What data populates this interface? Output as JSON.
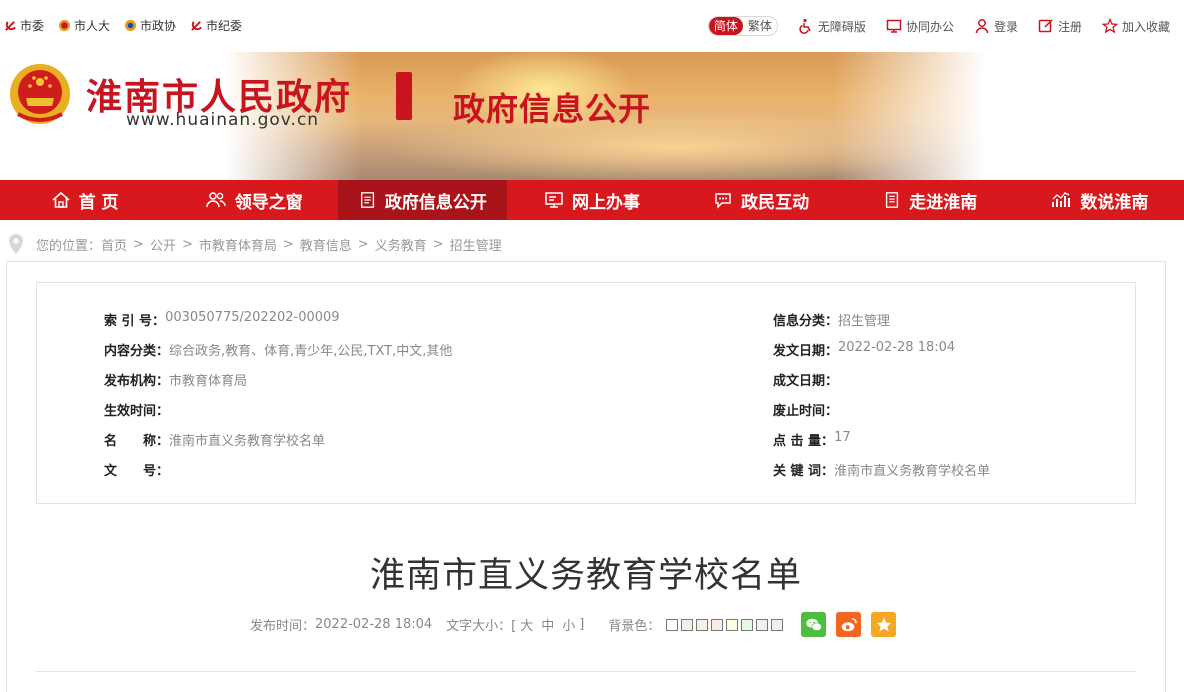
{
  "top_links_left": [
    {
      "label": "市委"
    },
    {
      "label": "市人大"
    },
    {
      "label": "市政协"
    },
    {
      "label": "市纪委"
    }
  ],
  "lang": {
    "simplified": "简体",
    "traditional": "繁体"
  },
  "top_links_right": {
    "accessible": "无障碍版",
    "office": "协同办公",
    "login": "登录",
    "register": "注册",
    "favorite": "加入收藏"
  },
  "banner": {
    "site_name": "淮南市人民政府",
    "site_url": "www.huainan.gov.cn",
    "section": "政府信息公开"
  },
  "nav": [
    {
      "label": "首 页"
    },
    {
      "label": "领导之窗"
    },
    {
      "label": "政府信息公开"
    },
    {
      "label": "网上办事"
    },
    {
      "label": "政民互动"
    },
    {
      "label": "走进淮南"
    },
    {
      "label": "数说淮南"
    }
  ],
  "breadcrumb": {
    "prefix": "您的位置：",
    "items": [
      "首页",
      "公开",
      "市教育体育局",
      "教育信息",
      "义务教育",
      "招生管理"
    ],
    "sep": ">"
  },
  "meta": {
    "index_no": {
      "k": "索 引 号：",
      "v": "003050775/202202-00009"
    },
    "content_cat": {
      "k": "内容分类：",
      "v": "综合政务,教育、体育,青少年,公民,TXT,中文,其他"
    },
    "publisher": {
      "k": "发布机构：",
      "v": "市教育体育局"
    },
    "effective": {
      "k": "生效时间：",
      "v": ""
    },
    "name": {
      "k": "名　　称：",
      "v": "淮南市直义务教育学校名单"
    },
    "doc_no": {
      "k": "文　　号：",
      "v": ""
    },
    "info_cat": {
      "k": "信息分类：",
      "v": "招生管理"
    },
    "issue_date": {
      "k": "发文日期：",
      "v": "2022-02-28 18:04"
    },
    "written_date": {
      "k": "成文日期：",
      "v": ""
    },
    "repeal": {
      "k": "废止时间：",
      "v": ""
    },
    "hits": {
      "k": "点 击 量：",
      "v": "17"
    },
    "keywords": {
      "k": "关 键 词：",
      "v": "淮南市直义务教育学校名单"
    }
  },
  "article": {
    "title": "淮南市直义务教育学校名单",
    "pub_label": "发布时间：",
    "pub_time": "2022-02-28 18:04",
    "font_size_label": "文字大小：[",
    "font_sizes": [
      "大",
      "中",
      "小"
    ],
    "font_size_end": "]",
    "bg_label": "背景色：",
    "bg_colors": [
      "#ffffff",
      "#f3f0e4",
      "#f6f0e8",
      "#fbe9e6",
      "#fdfde0",
      "#e7f7e9",
      "#eef2f8",
      "#f0f0f0"
    ]
  },
  "colors": {
    "brand_red": "#c8141e",
    "nav_red": "#d7191e",
    "nav_active": "#a8141a"
  }
}
